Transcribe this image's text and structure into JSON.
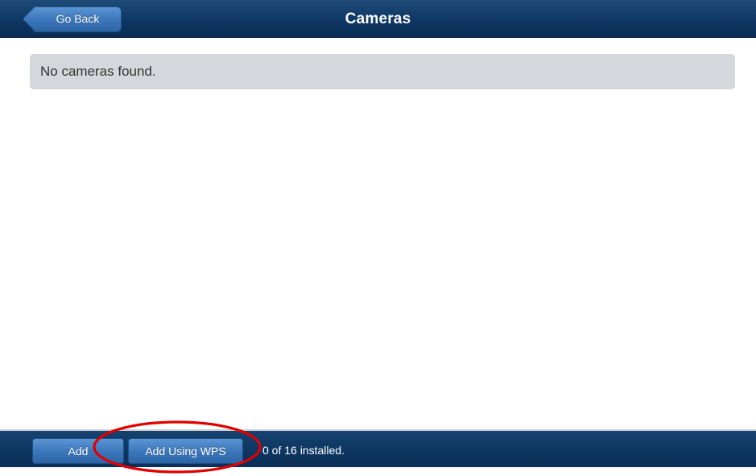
{
  "header": {
    "title": "Cameras",
    "back_label": "Go Back"
  },
  "main": {
    "empty_message": "No cameras found."
  },
  "footer": {
    "add_label": "Add",
    "add_wps_label": "Add Using WPS",
    "install_status": "0 of 16 installed."
  },
  "icons": {
    "back": "chevron-left-icon",
    "annotation": "red-ellipse-highlight"
  },
  "colors": {
    "header_bg": "#0e3763",
    "button_blue": "#3d78bc",
    "panel_gray": "#d4d8dc",
    "annotation_red": "#e00000"
  }
}
